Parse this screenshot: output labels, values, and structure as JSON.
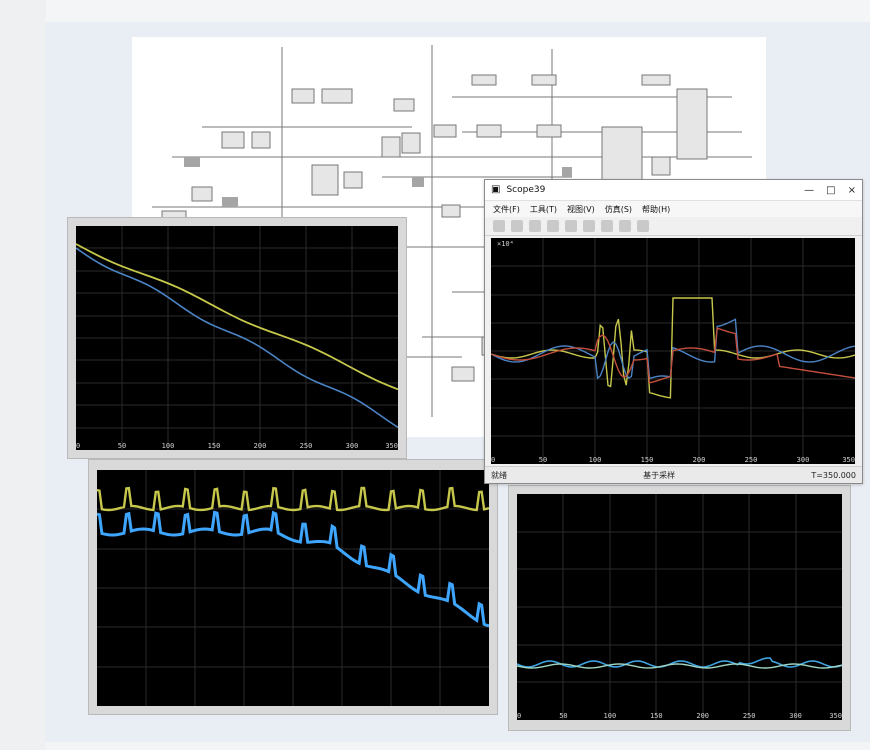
{
  "scope_window": {
    "title": "Scope39",
    "menu": [
      "文件(F)",
      "工具(T)",
      "视图(V)",
      "仿真(S)",
      "帮助(H)"
    ],
    "status_left": "就绪",
    "status_mid": "基于采样",
    "status_right": "T=350.000",
    "y_exponent": "×10⁴"
  },
  "plot_top_left": {
    "x_ticks": [
      "0",
      "50",
      "100",
      "150",
      "200",
      "250",
      "300",
      "350"
    ]
  },
  "plot_scope": {
    "x_ticks": [
      "0",
      "50",
      "100",
      "150",
      "200",
      "250",
      "300",
      "350"
    ]
  },
  "plot_bottom_right": {
    "x_ticks": [
      "0",
      "50",
      "100",
      "150",
      "200",
      "250",
      "300",
      "350"
    ]
  },
  "colors": {
    "yellow": "#c7c84b",
    "blue": "#4b84c5",
    "red": "#c24f3b",
    "cyan": "#3fa3df",
    "bright_blue": "#3fa6ff"
  }
}
